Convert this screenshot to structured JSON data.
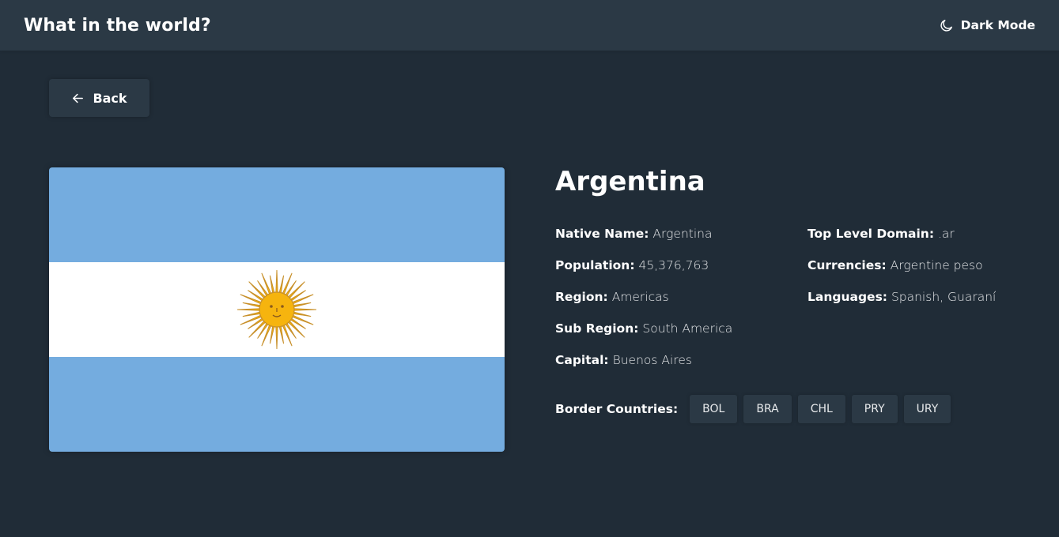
{
  "header": {
    "title": "What in the world?",
    "mode_label": "Dark Mode",
    "mode_icon": "moon-icon"
  },
  "back_button": {
    "label": "Back",
    "icon": "arrow-left-icon"
  },
  "country": {
    "name": "Argentina",
    "flag_icon": "argentina-flag",
    "details_left": [
      {
        "label": "Native Name:",
        "value": "Argentina"
      },
      {
        "label": "Population:",
        "value": "45,376,763"
      },
      {
        "label": "Region:",
        "value": "Americas"
      },
      {
        "label": "Sub Region:",
        "value": "South America"
      },
      {
        "label": "Capital:",
        "value": "Buenos Aires"
      }
    ],
    "details_right": [
      {
        "label": "Top Level Domain:",
        "value": ".ar"
      },
      {
        "label": "Currencies:",
        "value": "Argentine peso"
      },
      {
        "label": "Languages:",
        "value": "Spanish, Guaraní"
      }
    ],
    "border_label": "Border Countries:",
    "borders": [
      "BOL",
      "BRA",
      "CHL",
      "PRY",
      "URY"
    ]
  },
  "colors": {
    "background": "#202c37",
    "elements": "#2b3945",
    "flag_blue": "#74acdf",
    "flag_white": "#ffffff",
    "sun": "#f6b40e"
  }
}
